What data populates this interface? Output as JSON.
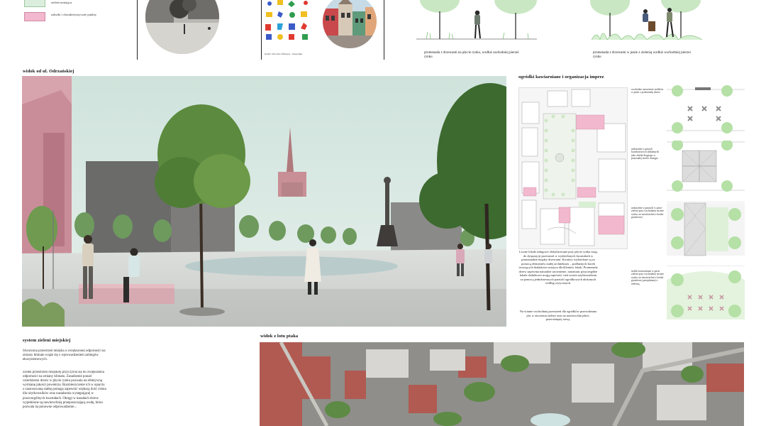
{
  "top_strip": {
    "legend": [
      {
        "label": "zieleń istniejąca",
        "swatch": "#dbeedd"
      },
      {
        "label": "zabytki i charakterystyczne punkty",
        "swatch": "#f2b8cd"
      }
    ],
    "photo_credit": "źródło: Wrocław Ołtarzyn... fotopolska",
    "promenades": [
      {
        "caption": "promenada z drzewami na płycie rynku, wzdłuż zachodniej pierzei rynku"
      },
      {
        "caption": "promenada z drzewami w pasie z zielenią wzdłuż wschodniej pierzei rynku"
      }
    ]
  },
  "view_section": {
    "title": "widok od ul. Odrzańskiej"
  },
  "cafe_section": {
    "title": "ogródki kawiarniane i organizacja imprez",
    "annotations": [
      "swobodne ustawienie stolików w pasie z promenadą drzew",
      "zadaszenie z paraoli kwadratowych składanych jako obiekt drugiego w pozostałej strefie dostępu",
      "zadaszenie z parasoli w pasie zieleni przy wschodniej stronie rynku, na nawierzchni z kostki granitowej",
      "stoliki kawiarniane w pasie zieleni przy wschodniej stronie rynku, na nawierzchni z kostki granitowej przeplatanej z zielenią"
    ],
    "description": "Liczne lokale usługowe zlokalizowane przy płycie rynku mają do dyspozycji przestrzeń w wydzielonych kwartałach w promenadzie między drzewami. Kwatery wydzielone są za pomocą elementów małej architektury – podłużnych ławek tworzących dodatkowe miejsca dla klientów lokali. Promenada drzew zapewnia naturalne zacienienie, natomiast poszczególne lokale dodatkowo mogą zapewnić cień swoim użytkownikom za pomocą jednobarwnych parasoli ogródkowych ułożonych według wytycznych.",
    "description2": "Na ścianie wschodniej przestrzeń dla ogródków przewidziana jest w otoczeniu zieleni oraz na nawierzchni płace, przerośniętej trawą."
  },
  "green_section": {
    "title": "system zieleni miejskiej",
    "para1": "Stworzona przestrzeń miejska o zwiększonej odporności na zmiany klimatu wiąże się z wprowadzeniem zabiegów ekosystemowych.",
    "para2": "Zieleń przestrzeni miejskiej przyczynia się do zwiększenia odporności na zmiany klimatu. Zasadzenie ponad czterdziestu drzew w płycie rynku pozwala na efektywną wymianę jakości powietrza. Rozmieszczenie ich w oparciu o zastosowaną siatkę pomaga zapewnić większą ilość cienia dla użytkowników oraz nasadzenia występującej w poszczególnych kwartałach. Okręgi w nasadach drzew wypełnione są nawierzchnią przepuszczającą wodę, która pozwala na ponowne odprowadzenie..."
  },
  "aerial_section": {
    "title": "widok z lotu ptaka"
  }
}
